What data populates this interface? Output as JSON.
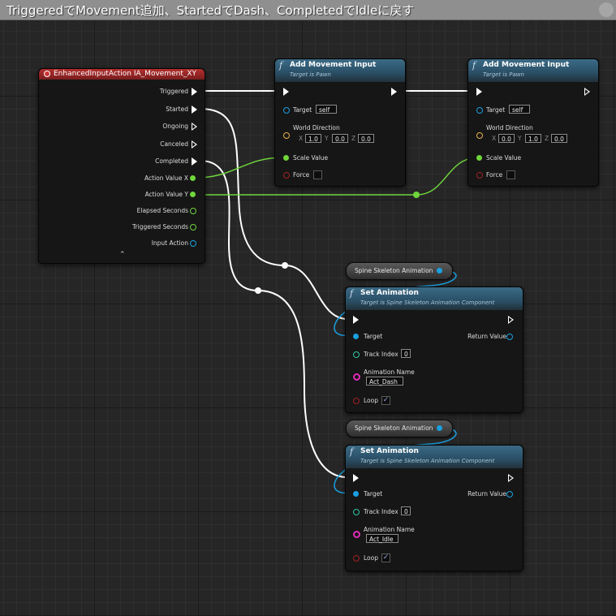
{
  "comment": {
    "title": "TriggeredでMovement追加、StartedでDash、CompletedでIdleに戻す"
  },
  "event_node": {
    "title": "EnhancedInputAction IA_Movement_XY",
    "pins": {
      "triggered": "Triggered",
      "started": "Started",
      "ongoing": "Ongoing",
      "canceled": "Canceled",
      "completed": "Completed",
      "action_value_x": "Action Value X",
      "action_value_y": "Action Value Y",
      "elapsed_seconds": "Elapsed Seconds",
      "triggered_seconds": "Triggered Seconds",
      "input_action": "Input Action"
    }
  },
  "add_movement_1": {
    "title": "Add Movement Input",
    "subtitle": "Target is Pawn",
    "target_label": "Target",
    "target_value": "self",
    "world_direction_label": "World Direction",
    "x": "1.0",
    "y": "0.0",
    "z": "0.0",
    "scale_value_label": "Scale Value",
    "force_label": "Force"
  },
  "add_movement_2": {
    "title": "Add Movement Input",
    "subtitle": "Target is Pawn",
    "target_label": "Target",
    "target_value": "self",
    "world_direction_label": "World Direction",
    "x": "0.0",
    "y": "1.0",
    "z": "0.0",
    "scale_value_label": "Scale Value",
    "force_label": "Force"
  },
  "axis_labels": {
    "x": "X",
    "y": "Y",
    "z": "Z"
  },
  "spine_var_1": {
    "label": "Spine Skeleton Animation"
  },
  "spine_var_2": {
    "label": "Spine Skeleton Animation"
  },
  "set_anim_1": {
    "title": "Set Animation",
    "subtitle": "Target is Spine Skeleton Animation Component",
    "target_label": "Target",
    "return_label": "Return Value",
    "track_index_label": "Track Index",
    "track_index_value": "0",
    "animation_name_label": "Animation Name",
    "animation_name_value": "Act_Dash",
    "loop_label": "Loop",
    "loop_checked": true
  },
  "set_anim_2": {
    "title": "Set Animation",
    "subtitle": "Target is Spine Skeleton Animation Component",
    "target_label": "Target",
    "return_label": "Return Value",
    "track_index_label": "Track Index",
    "track_index_value": "0",
    "animation_name_label": "Animation Name",
    "animation_name_value": "Act_Idle",
    "loop_label": "Loop",
    "loop_checked": true
  },
  "colors": {
    "exec_wire": "#ffffff",
    "float_wire": "#6fd63b",
    "object_wire": "#1aa0e0",
    "event_header": "#b32f2f",
    "function_header": "#3b6a85"
  },
  "icons": {
    "function": "function-icon",
    "event": "event-icon",
    "check": "checkmark-icon",
    "collapse": "chevron-up-icon"
  }
}
